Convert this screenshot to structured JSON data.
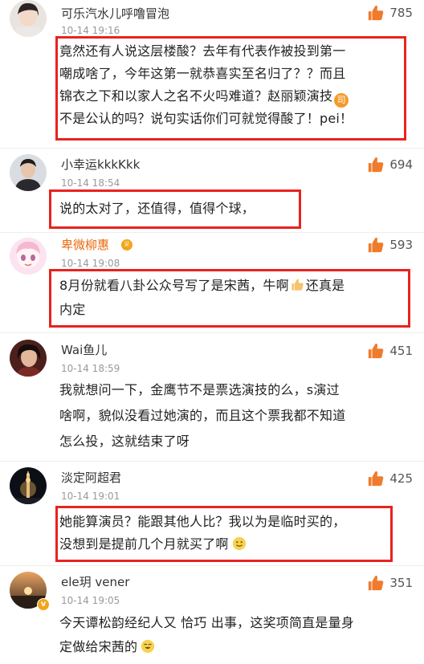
{
  "comments": [
    {
      "username": "可乐汽水儿呼噜冒泡",
      "time": "10-14 19:16",
      "likes": "785",
      "lines": [
        "竟然还有人说这层楼酸？去年有代表作被投到第一",
        "嘲成啥了，今年这第一就恭喜实至名归了？？而且",
        "锦衣之下和以家人之名不火吗难道？赵丽颖演技",
        "不是公认的吗？说句实话你们可就觉得酸了！pei！"
      ],
      "emoji_glyph": "司",
      "highlighted": true
    },
    {
      "username": "小幸运kkkKkk",
      "time": "10-14 18:54",
      "likes": "694",
      "lines": [
        "说的太对了，还值得，值得个球，"
      ],
      "highlighted": true
    },
    {
      "username": "卑微柳惠",
      "time": "10-14 19:08",
      "likes": "593",
      "lines": [
        "8月份就看八卦公众号写了是宋茜，牛啊",
        "还真是",
        "内定"
      ],
      "highlighted": true
    },
    {
      "username": "Wai鱼儿",
      "time": "10-14 18:59",
      "likes": "451",
      "lines": [
        "我就想问一下，金鹰节不是票选演技的么，s演过",
        "啥啊，貌似没看过她演的，而且这个票我都不知道",
        "怎么投，这就结束了呀"
      ],
      "highlighted": false
    },
    {
      "username": "淡定阿超君",
      "time": "10-14 19:01",
      "likes": "425",
      "lines": [
        "她能算演员？能跟其他人比？我以为是临时买的，",
        "没想到是提前几个月就买了啊"
      ],
      "highlighted": true
    },
    {
      "username": "ele玥 vener",
      "time": "10-14 19:05",
      "likes": "351",
      "lines": [
        "今天谭松韵经纪人又 恰巧 出事，这奖项简直是量身",
        "定做给宋茜的"
      ],
      "highlighted": false
    }
  ],
  "colors": {
    "highlight_border": "#e8231f",
    "like_orange": "#f07b2c",
    "vip_name": "#e86a10",
    "timestamp": "#999999"
  },
  "icons": {
    "like": "thumbs-up-icon",
    "vip": "vip-crown-icon",
    "verified": "verified-badge-icon"
  }
}
